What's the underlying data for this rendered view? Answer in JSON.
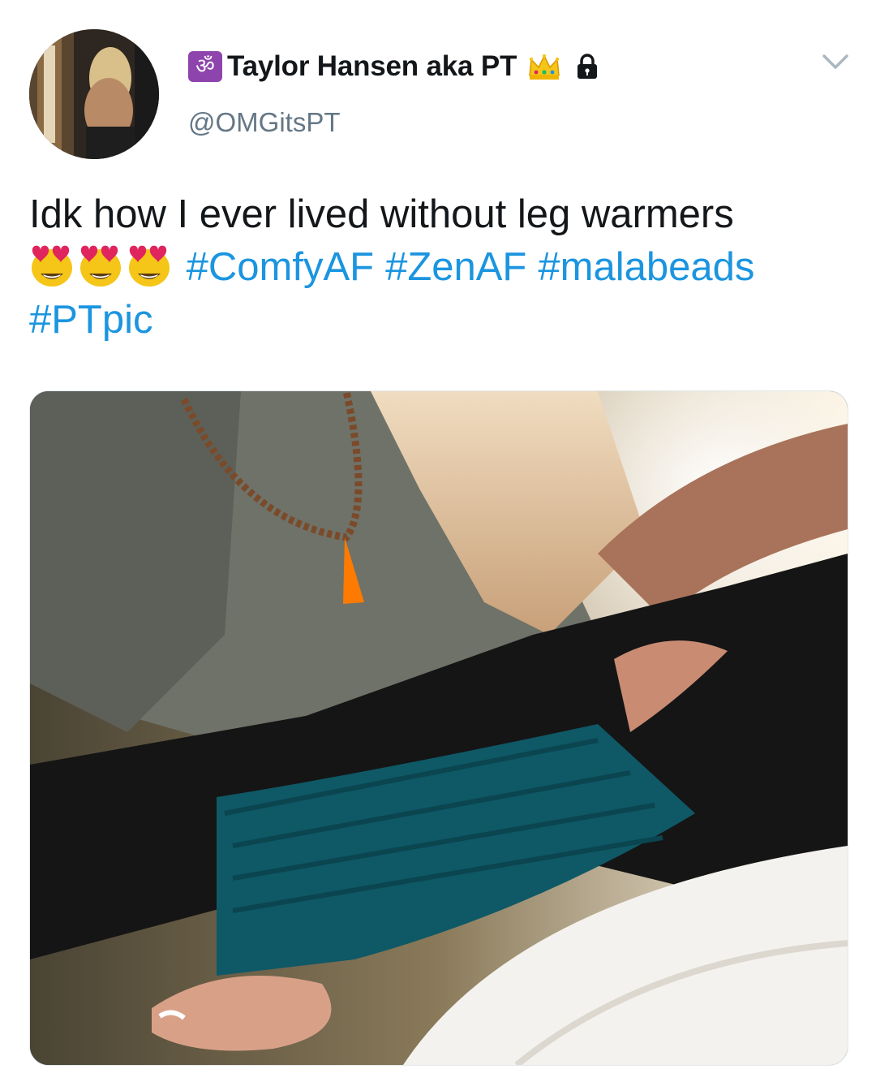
{
  "tweet": {
    "author": {
      "badge_glyph": "ॐ",
      "display_name": "Taylor Hansen aka PT",
      "handle": "@OMGitsPT",
      "icons": [
        "om-icon",
        "crown-icon",
        "lock-icon"
      ]
    },
    "menu_icon": "chevron-down-icon",
    "text_line1": "Idk how I ever lived without leg warmers",
    "emojis": [
      "heart-eyes-emoji",
      "heart-eyes-emoji",
      "heart-eyes-emoji"
    ],
    "hashtags": [
      "#ComfyAF",
      "#ZenAF",
      "#malabeads",
      "#PTpic"
    ],
    "media_icon": "photo-image"
  },
  "colors": {
    "link": "#1b95e0",
    "handle": "#657786",
    "text": "#14171a",
    "badge": "#8e44ad"
  }
}
